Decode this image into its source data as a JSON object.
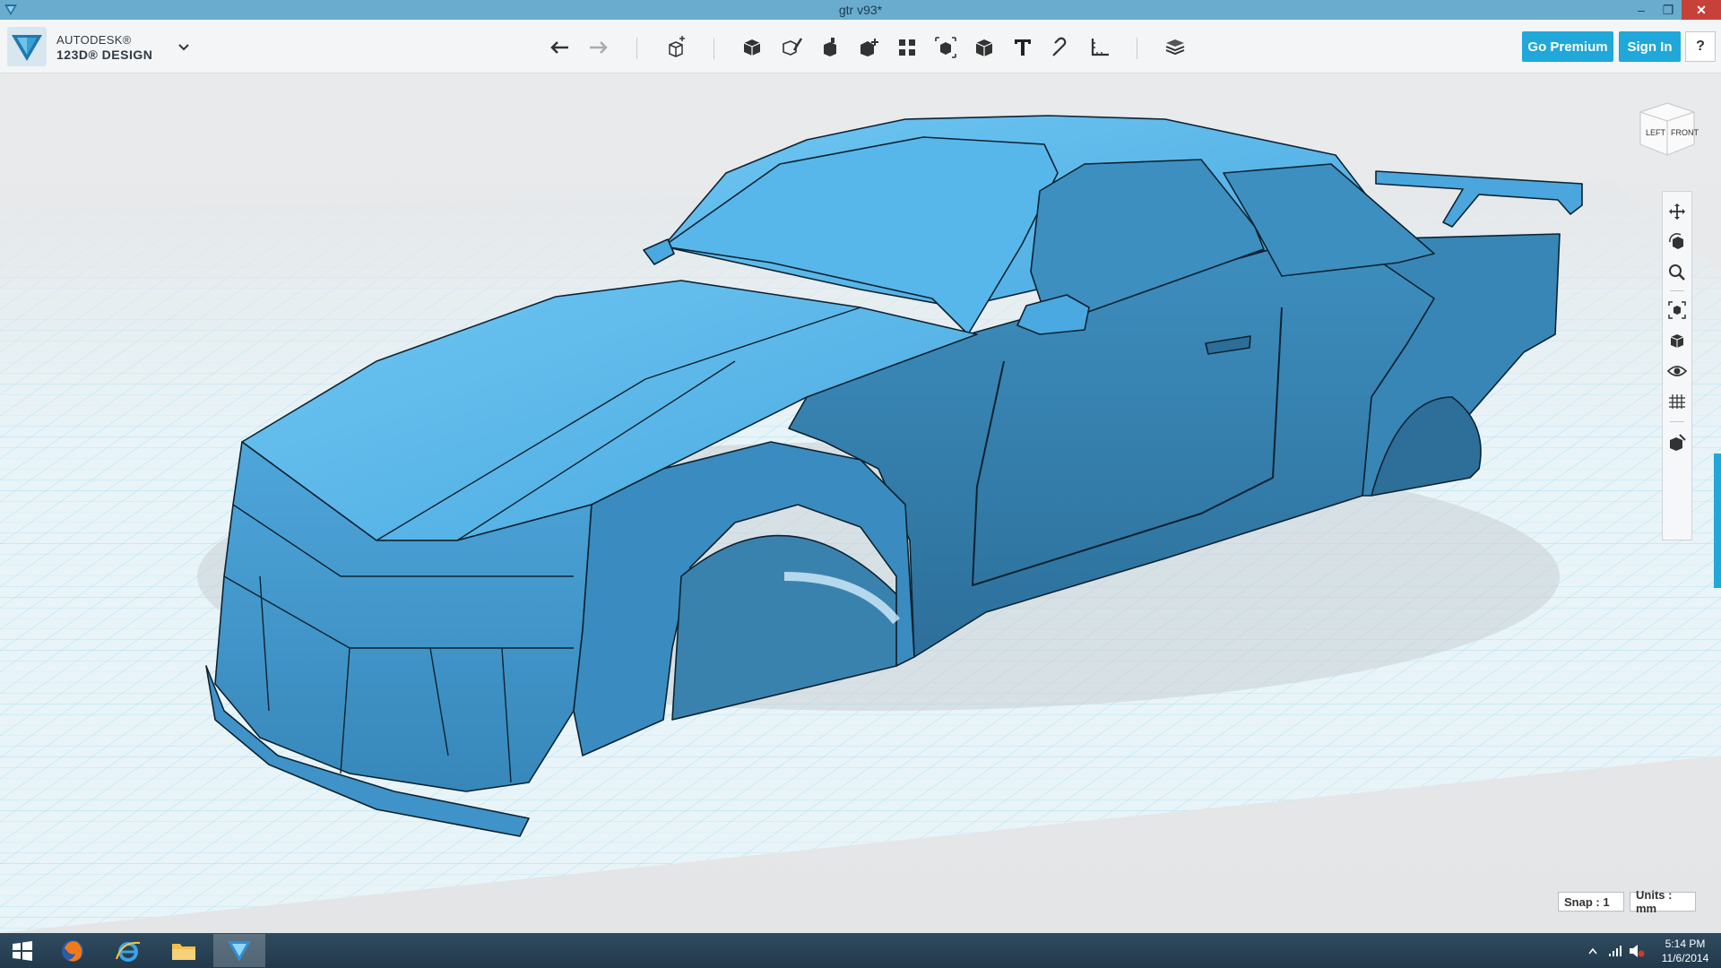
{
  "window": {
    "title": "gtr v93*",
    "minimize": "–",
    "maximize": "❐",
    "close": "✕"
  },
  "brand": {
    "line1": "AUTODESK®",
    "line2": "123D® DESIGN"
  },
  "toolbar": {
    "tools": [
      {
        "name": "undo-icon"
      },
      {
        "name": "redo-icon"
      },
      {
        "name": "transform-icon"
      },
      {
        "name": "primitives-icon"
      },
      {
        "name": "sketch-icon"
      },
      {
        "name": "construct-icon"
      },
      {
        "name": "modify-icon"
      },
      {
        "name": "pattern-icon"
      },
      {
        "name": "grouping-icon"
      },
      {
        "name": "combine-icon"
      },
      {
        "name": "text-icon"
      },
      {
        "name": "snap-icon"
      },
      {
        "name": "measure-icon"
      },
      {
        "name": "material-icon"
      }
    ],
    "go_premium": "Go Premium",
    "sign_in": "Sign In",
    "help": "?"
  },
  "viewcube": {
    "left": "LEFT",
    "front": "FRONT"
  },
  "nav_tools": [
    "pan-icon",
    "orbit-icon",
    "zoom-icon",
    "fit-icon",
    "views-icon",
    "visibility-icon",
    "grid-icon",
    "material-mode-icon"
  ],
  "status": {
    "snap": "Snap : 1",
    "units": "Units : mm"
  },
  "taskbar": {
    "apps": [
      "firefox-icon",
      "internet-explorer-icon",
      "file-explorer-icon",
      "123d-design-icon"
    ],
    "time": "5:14 PM",
    "date": "11/6/2014"
  },
  "colors": {
    "accent": "#1fa8d9",
    "model": "#3a8fc4",
    "titlebar": "#6aaccd"
  }
}
